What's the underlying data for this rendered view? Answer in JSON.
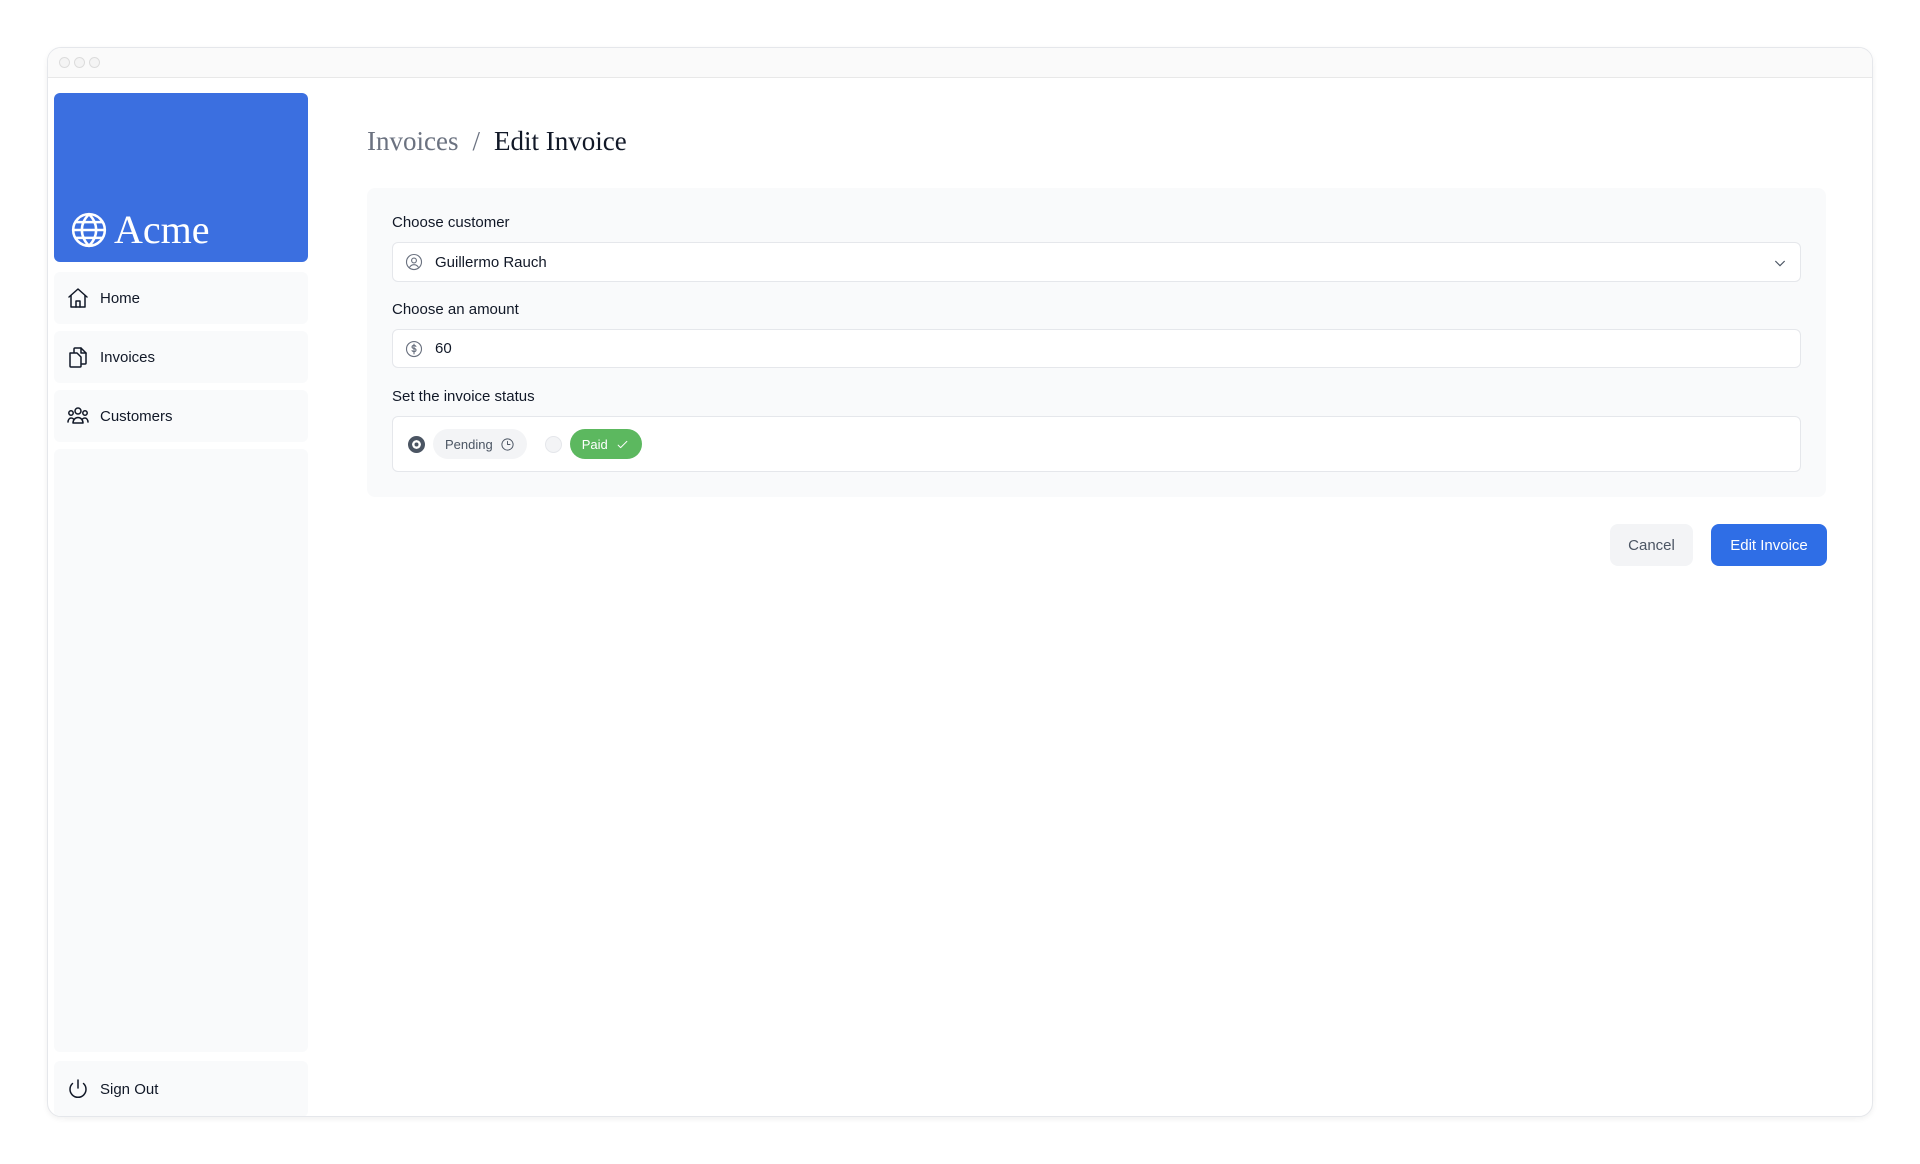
{
  "window": {
    "traffic_lights": [
      "close",
      "minimize",
      "maximize"
    ]
  },
  "sidebar": {
    "brand": {
      "name": "Acme",
      "icon": "globe-icon",
      "color": "#3b6fe0"
    },
    "items": [
      {
        "label": "Home",
        "icon": "home-icon"
      },
      {
        "label": "Invoices",
        "icon": "documents-icon"
      },
      {
        "label": "Customers",
        "icon": "users-icon"
      }
    ],
    "sign_out": {
      "label": "Sign Out",
      "icon": "power-icon"
    }
  },
  "breadcrumb": {
    "parent": "Invoices",
    "separator": "/",
    "current": "Edit Invoice"
  },
  "form": {
    "customer": {
      "label": "Choose customer",
      "value": "Guillermo Rauch",
      "icon": "user-circle-icon"
    },
    "amount": {
      "label": "Choose an amount",
      "value": "60",
      "icon": "dollar-icon"
    },
    "status": {
      "label": "Set the invoice status",
      "selected": "pending",
      "options": [
        {
          "value": "pending",
          "label": "Pending",
          "icon": "clock-icon",
          "color": "#f3f4f6"
        },
        {
          "value": "paid",
          "label": "Paid",
          "icon": "check-icon",
          "color": "#5cb85f"
        }
      ]
    }
  },
  "actions": {
    "cancel_label": "Cancel",
    "submit_label": "Edit Invoice",
    "submit_color": "#2f6ee6"
  }
}
